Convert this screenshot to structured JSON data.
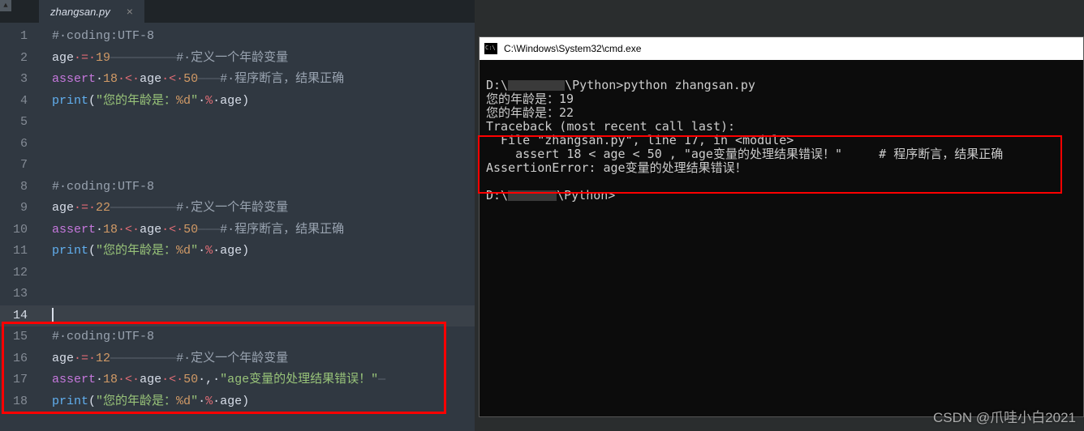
{
  "tab": {
    "name": "zhangsan.py",
    "close": "×"
  },
  "gutter": [
    "1",
    "2",
    "3",
    "4",
    "5",
    "6",
    "7",
    "8",
    "9",
    "10",
    "11",
    "12",
    "13",
    "14",
    "15",
    "16",
    "17",
    "18"
  ],
  "code": {
    "l1_comment": "#·coding:UTF-8",
    "l2_a": "age",
    "l2_eq": "·=·",
    "l2_n": "19",
    "l2_dash": "—————————",
    "l2_c": "#·定义一个年龄变量",
    "l3_kw": "assert",
    "l3_s": "·",
    "l3_n1": "18",
    "l3_op1": "·<·",
    "l3_v": "age",
    "l3_op2": "·<·",
    "l3_n2": "50",
    "l3_dash": "———",
    "l3_c": "#·程序断言，结果正确",
    "l4_fn": "print",
    "l4_p1": "(",
    "l4_str1": "\"您的年龄是：",
    "l4_fmt": "%d",
    "l4_str2": "\"",
    "l4_sp": "·",
    "l4_pct": "%",
    "l4_sp2": "·",
    "l4_v": "age",
    "l4_p2": ")",
    "l8_comment": "#·coding:UTF-8",
    "l9_a": "age",
    "l9_eq": "·=·",
    "l9_n": "22",
    "l9_dash": "—————————",
    "l9_c": "#·定义一个年龄变量",
    "l10_kw": "assert",
    "l10_s": "·",
    "l10_n1": "18",
    "l10_op1": "·<·",
    "l10_v": "age",
    "l10_op2": "·<·",
    "l10_n2": "50",
    "l10_dash": "———",
    "l10_c": "#·程序断言，结果正确",
    "l11_fn": "print",
    "l11_p1": "(",
    "l11_str1": "\"您的年龄是：",
    "l11_fmt": "%d",
    "l11_str2": "\"",
    "l11_sp": "·",
    "l11_pct": "%",
    "l11_sp2": "·",
    "l11_v": "age",
    "l11_p2": ")",
    "l15_comment": "#·coding:UTF-8",
    "l16_a": "age",
    "l16_eq": "·=·",
    "l16_n": "12",
    "l16_dash": "—————————",
    "l16_c": "#·定义一个年龄变量",
    "l17_kw": "assert",
    "l17_s": "·",
    "l17_n1": "18",
    "l17_op1": "·<·",
    "l17_v": "age",
    "l17_op2": "·<·",
    "l17_n2": "50",
    "l17_cm": "·,·",
    "l17_str": "\"age变量的处理结果错误！\"",
    "l17_dash": "—",
    "l18_fn": "print",
    "l18_p1": "(",
    "l18_str1": "\"您的年龄是：",
    "l18_fmt": "%d",
    "l18_str2": "\"",
    "l18_sp": "·",
    "l18_pct": "%",
    "l18_sp2": "·",
    "l18_v": "age",
    "l18_p2": ")"
  },
  "cmd": {
    "title": "C:\\Windows\\System32\\cmd.exe",
    "l1a": "D:\\",
    "l1b": "\\Python>python zhangsan.py",
    "l2": "您的年龄是：19",
    "l3": "您的年龄是：22",
    "l4": "Traceback (most recent call last):",
    "l5": "  File \"zhangsan.py\", line 17, in <module>",
    "l6": "    assert 18 < age < 50 , \"age变量的处理结果错误！\"     # 程序断言，结果正确",
    "l7": "AssertionError: age变量的处理结果错误！",
    "l8a": "D:\\",
    "l8b": "\\Python>"
  },
  "watermark": "CSDN @爪哇小白2021"
}
